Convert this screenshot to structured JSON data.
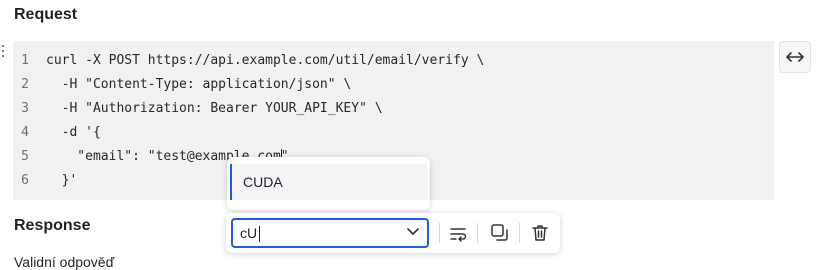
{
  "request": {
    "title": "Request"
  },
  "code": {
    "lines": [
      {
        "num": "1",
        "text": "curl -X POST https://api.example.com/util/email/verify \\"
      },
      {
        "num": "2",
        "text": "  -H \"Content-Type: application/json\" \\"
      },
      {
        "num": "3",
        "text": "  -H \"Authorization: Bearer YOUR_API_KEY\" \\"
      },
      {
        "num": "4",
        "text": "  -d '{"
      },
      {
        "num": "5",
        "text": "    \"email\": \"test@example.com\""
      },
      {
        "num": "6",
        "text": "  }'"
      }
    ]
  },
  "suggestion": {
    "label": "CUDA"
  },
  "language_select": {
    "value": "cU"
  },
  "response": {
    "title": "Response",
    "partial_text": "Validní odpověď"
  },
  "icons": {
    "expand": "expand-horizontal-icon",
    "wrap": "wrap-lines-icon",
    "copy": "copy-icon",
    "delete": "trash-icon",
    "chevron": "chevron-down-icon",
    "drag": "drag-handle-icon"
  },
  "colors": {
    "accent": "#1e5fd4",
    "editor_bg": "#f1f1f1"
  }
}
